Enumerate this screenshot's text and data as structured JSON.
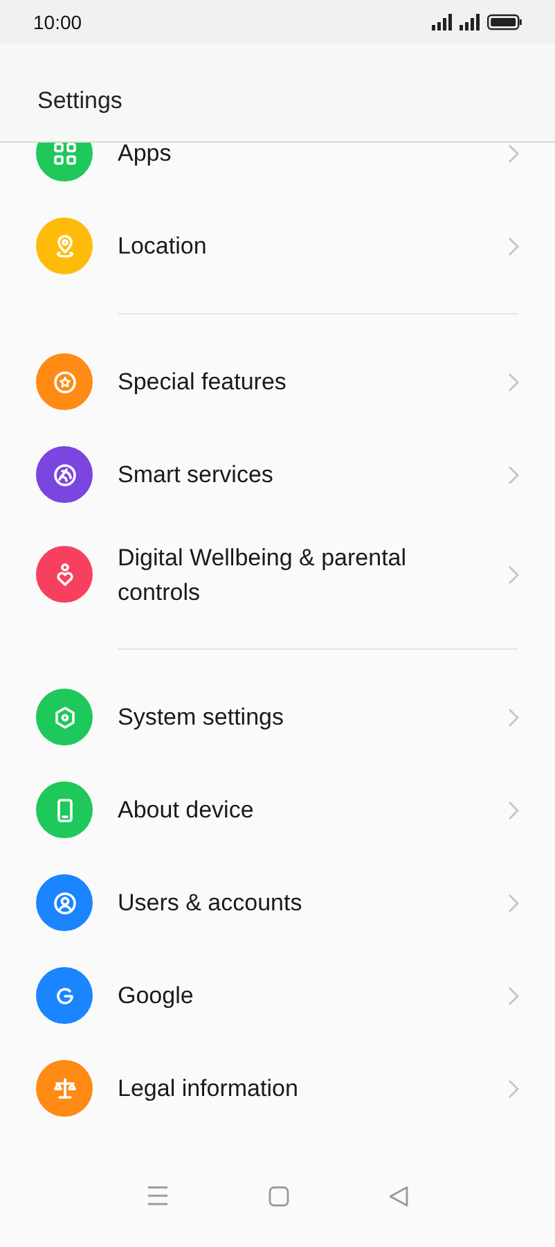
{
  "status_bar": {
    "time": "10:00"
  },
  "header": {
    "title": "Settings"
  },
  "groups": [
    {
      "items": [
        {
          "label": "Apps",
          "color": "#1ec85a"
        },
        {
          "label": "Location",
          "color": "#ffbb0a"
        }
      ]
    },
    {
      "items": [
        {
          "label": "Special features",
          "color": "#ff8a14"
        },
        {
          "label": "Smart services",
          "color": "#7b45e0"
        },
        {
          "label": "Digital Wellbeing & parental controls",
          "color": "#f7405f"
        }
      ]
    },
    {
      "items": [
        {
          "label": "System settings",
          "color": "#1ec85a"
        },
        {
          "label": "About device",
          "color": "#1ec85a"
        },
        {
          "label": "Users & accounts",
          "color": "#1a85ff"
        },
        {
          "label": "Google",
          "color": "#1a85ff"
        },
        {
          "label": "Legal information",
          "color": "#ff8a14"
        }
      ]
    }
  ]
}
